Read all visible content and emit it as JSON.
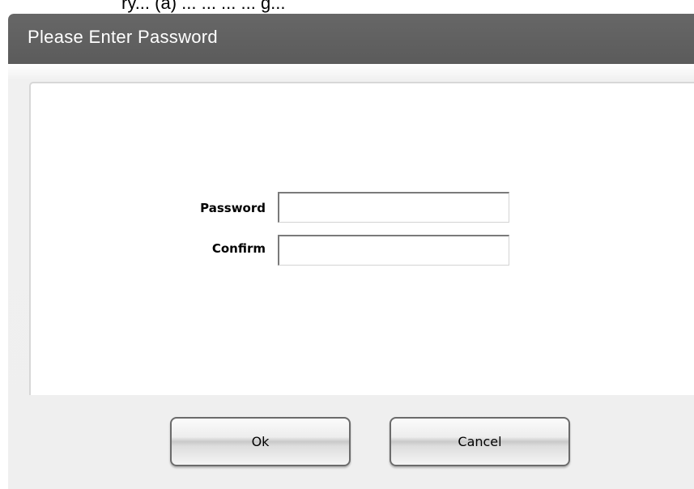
{
  "background_snippet": "ry... (a) ... ... ... ... g...",
  "dialog": {
    "title": "Please Enter Password",
    "fields": {
      "password_label": "Password",
      "password_value": "",
      "confirm_label": "Confirm",
      "confirm_value": ""
    },
    "buttons": {
      "ok_label": "Ok",
      "cancel_label": "Cancel"
    }
  },
  "colors": {
    "title_bar": "#5e5e5e",
    "title_text": "#ffffff",
    "dialog_bg": "#efefef",
    "panel_bg": "#ffffff"
  }
}
